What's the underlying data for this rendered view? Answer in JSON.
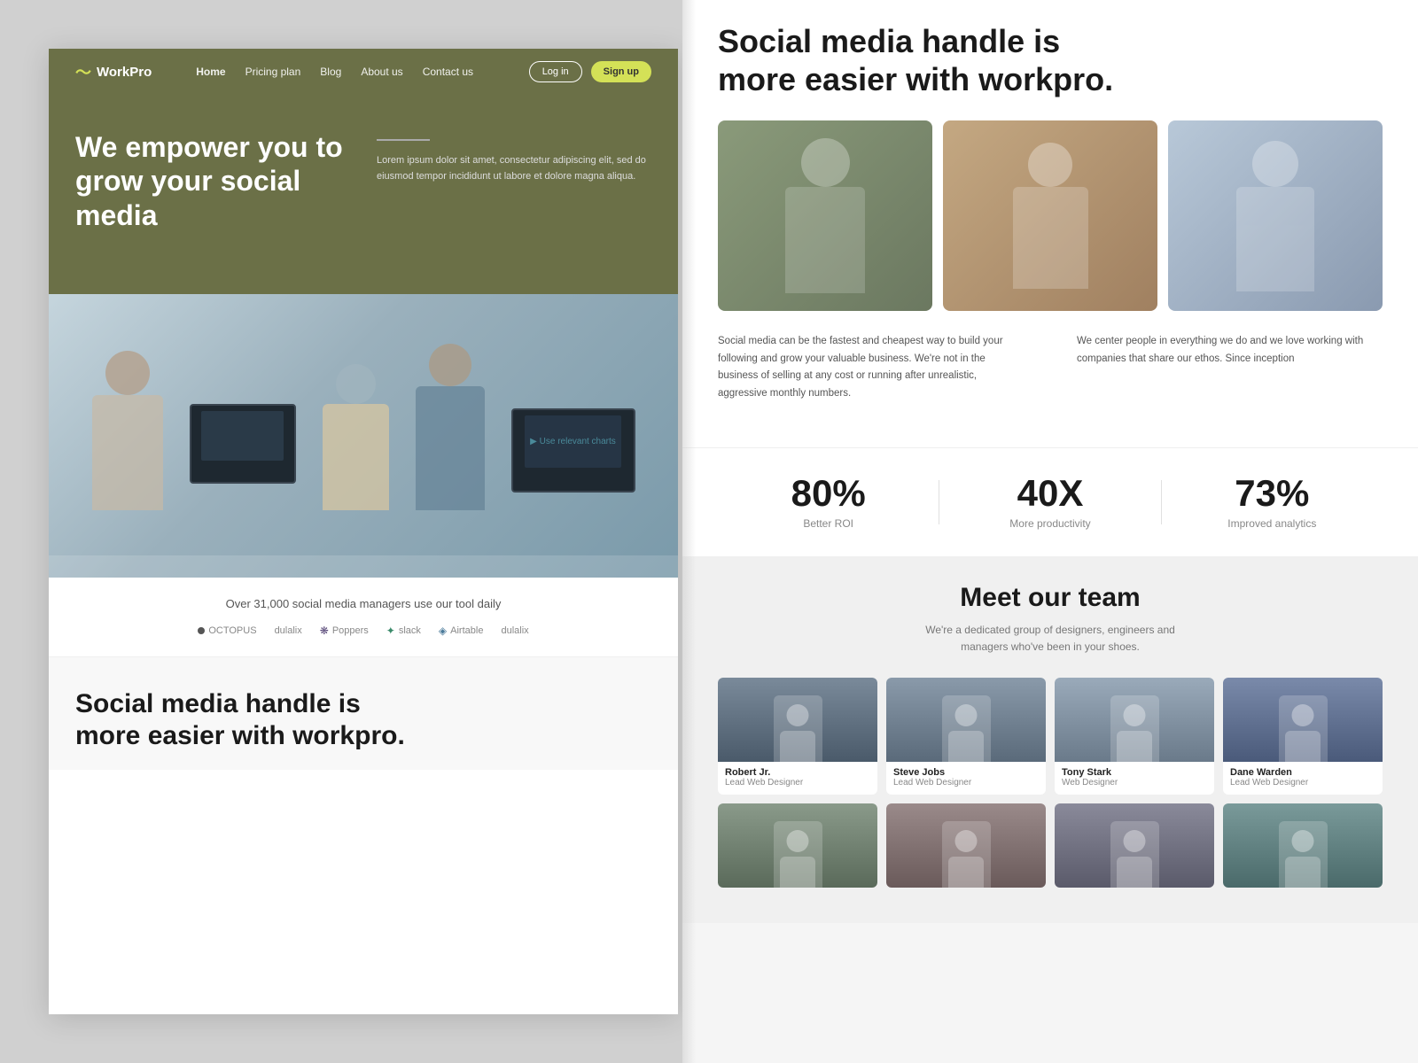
{
  "meta": {
    "bg_color": "#d0d0d0"
  },
  "left_panel": {
    "navbar": {
      "logo": "WorkPro",
      "links": [
        {
          "label": "Home",
          "active": true
        },
        {
          "label": "Pricing plan"
        },
        {
          "label": "Blog"
        },
        {
          "label": "About us"
        },
        {
          "label": "Contact us"
        }
      ],
      "login_label": "Log in",
      "signup_label": "Sign up"
    },
    "hero": {
      "title": "We empower you to grow your social media",
      "description": "Lorem ipsum dolor sit amet, consectetur adipiscing elit, sed do eiusmod tempor incididunt ut labore et dolore magna aliqua."
    },
    "stats_strip": {
      "text": "Over 31,000 social media managers use our tool daily",
      "brands": [
        "OCTOPUS",
        "dulalix",
        "Poppers",
        "slack",
        "Airtable",
        "dulalix"
      ]
    },
    "social_section": {
      "title": "Social media handle is more easier with workpro."
    }
  },
  "right_panel": {
    "main_title": "Social media handle is more easier with workpro.",
    "description_left": "Social media can be the fastest and cheapest way to build your following and grow your valuable business. We're not in the business of selling at any cost or running after unrealistic, aggressive monthly numbers.",
    "description_right": "We center people in everything we do and we love working with companies that share our ethos. Since inception",
    "stats": [
      {
        "number": "80%",
        "label": "Better ROI"
      },
      {
        "number": "40X",
        "label": "More productivity"
      },
      {
        "number": "73%",
        "label": "Improved analytics"
      }
    ],
    "team_section": {
      "title": "Meet our team",
      "subtitle": "We're a dedicated group of designers, engineers and managers who've been in your shoes.",
      "members": [
        {
          "name": "Robert Jr.",
          "role": "Lead Web Designer"
        },
        {
          "name": "Steve Jobs",
          "role": "Lead Web Designer"
        },
        {
          "name": "Tony Stark",
          "role": "Web Designer"
        },
        {
          "name": "Dane Warden",
          "role": "Lead Web Designer"
        },
        {
          "name": "",
          "role": ""
        },
        {
          "name": "",
          "role": ""
        },
        {
          "name": "",
          "role": ""
        },
        {
          "name": "",
          "role": ""
        }
      ]
    }
  }
}
